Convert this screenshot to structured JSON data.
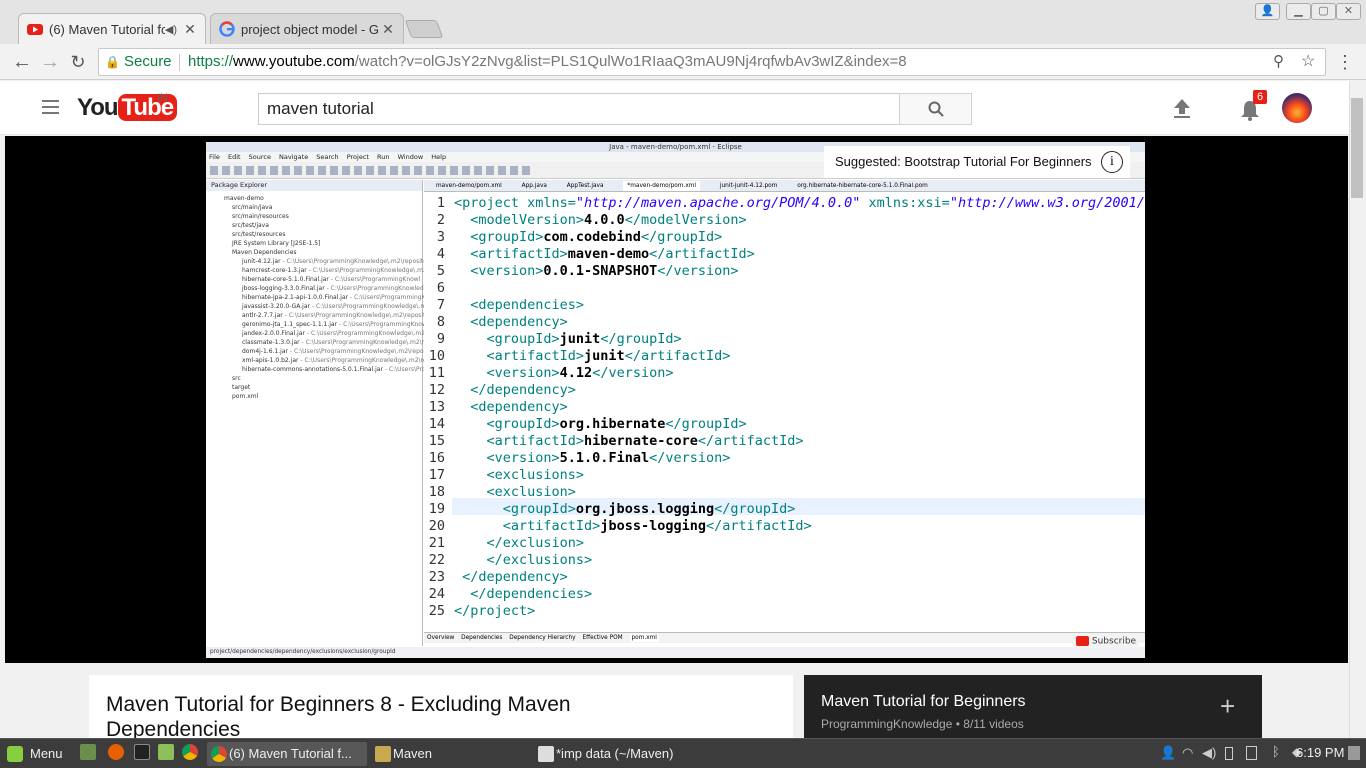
{
  "browser": {
    "tabs": [
      {
        "title": "(6) Maven Tutorial fo",
        "active": true
      },
      {
        "title": "project object model - G",
        "active": false
      }
    ],
    "secure_label": "Secure",
    "url_scheme": "https://",
    "url_host": "www.youtube.com",
    "url_path": "/watch?v=olGJsY2zNvg&list=PLS1QulWo1RIaaQ3mAU9Nj4rqfwbAv3wIZ&index=8"
  },
  "youtube": {
    "logo_text": "YouTube",
    "region": "IN",
    "search_value": "maven tutorial",
    "notification_count": "6"
  },
  "video": {
    "suggested": "Suggested: Bootstrap Tutorial For Beginners",
    "subscribe": "Subscribe",
    "eclipse": {
      "title": "Java - maven-demo/pom.xml - Eclipse",
      "menu": [
        "File",
        "Edit",
        "Source",
        "Navigate",
        "Search",
        "Project",
        "Run",
        "Window",
        "Help"
      ],
      "package_explorer_title": "Package Explorer",
      "tree": [
        {
          "label": "maven-demo",
          "path": ""
        },
        {
          "label": "src/main/java",
          "path": ""
        },
        {
          "label": "src/main/resources",
          "path": ""
        },
        {
          "label": "src/test/java",
          "path": ""
        },
        {
          "label": "src/test/resources",
          "path": ""
        },
        {
          "label": "JRE System Library [J2SE-1.5]",
          "path": ""
        },
        {
          "label": "Maven Dependencies",
          "path": ""
        },
        {
          "label": "junit-4.12.jar",
          "path": " - C:\\Users\\ProgrammingKnowledge\\.m2\\repository"
        },
        {
          "label": "hamcrest-core-1.3.jar",
          "path": " - C:\\Users\\ProgrammingKnowledge\\.m2\\re"
        },
        {
          "label": "hibernate-core-5.1.0.Final.jar",
          "path": " - C:\\Users\\ProgrammingKnowl"
        },
        {
          "label": "jboss-logging-3.3.0.Final.jar",
          "path": " - C:\\Users\\ProgrammingKnowledg"
        },
        {
          "label": "hibernate-jpa-2.1-api-1.0.0.Final.jar",
          "path": " - C:\\Users\\ProgrammingK"
        },
        {
          "label": "javassist-3.20.0-GA.jar",
          "path": " - C:\\Users\\ProgrammingKnowledge\\.m2"
        },
        {
          "label": "antlr-2.7.7.jar",
          "path": " - C:\\Users\\ProgrammingKnowledge\\.m2\\repositor"
        },
        {
          "label": "geronimo-jta_1.1_spec-1.1.1.jar",
          "path": " - C:\\Users\\ProgrammingKnowl"
        },
        {
          "label": "jandex-2.0.0.Final.jar",
          "path": " - C:\\Users\\ProgrammingKnowledge\\.m2\\re"
        },
        {
          "label": "classmate-1.3.0.jar",
          "path": " - C:\\Users\\ProgrammingKnowledge\\.m2\\repo"
        },
        {
          "label": "dom4j-1.6.1.jar",
          "path": " - C:\\Users\\ProgrammingKnowledge\\.m2\\reposito"
        },
        {
          "label": "xml-apis-1.0.b2.jar",
          "path": " - C:\\Users\\ProgrammingKnowledge\\.m2\\repo"
        },
        {
          "label": "hibernate-commons-annotations-5.0.1.Final.jar",
          "path": " - C:\\Users\\Progra"
        },
        {
          "label": "src",
          "path": ""
        },
        {
          "label": "target",
          "path": ""
        },
        {
          "label": "pom.xml",
          "path": ""
        }
      ],
      "editor_tabs": [
        "maven-demo/pom.xml",
        "App.java",
        "AppTest.java",
        "*maven-demo/pom.xml",
        "junit-junit-4.12.pom",
        "org.hibernate-hibernate-core-5.1.0.Final.pom"
      ],
      "code_lines": [
        {
          "n": "1",
          "parts": [
            [
              "tag",
              "<project xmlns="
            ],
            [
              "str",
              "\"http://maven.apache.org/POM/4.0.0\""
            ],
            [
              "tag",
              " xmlns:xsi="
            ],
            [
              "str",
              "\"http://www.w3.org/2001/"
            ]
          ]
        },
        {
          "n": "2",
          "parts": [
            [
              "tag",
              "  <modelVersion>"
            ],
            [
              "txt",
              "4.0.0"
            ],
            [
              "tag",
              "</modelVersion>"
            ]
          ]
        },
        {
          "n": "3",
          "parts": [
            [
              "tag",
              "  <groupId>"
            ],
            [
              "txt",
              "com.codebind"
            ],
            [
              "tag",
              "</groupId>"
            ]
          ]
        },
        {
          "n": "4",
          "parts": [
            [
              "tag",
              "  <artifactId>"
            ],
            [
              "txt",
              "maven-demo"
            ],
            [
              "tag",
              "</artifactId>"
            ]
          ]
        },
        {
          "n": "5",
          "parts": [
            [
              "tag",
              "  <version>"
            ],
            [
              "txt",
              "0.0.1-SNAPSHOT"
            ],
            [
              "tag",
              "</version>"
            ]
          ]
        },
        {
          "n": "6",
          "parts": []
        },
        {
          "n": "7",
          "parts": [
            [
              "tag",
              "  <dependencies>"
            ]
          ]
        },
        {
          "n": "8",
          "parts": [
            [
              "tag",
              "  <dependency>"
            ]
          ]
        },
        {
          "n": "9",
          "parts": [
            [
              "tag",
              "    <groupId>"
            ],
            [
              "txt",
              "junit"
            ],
            [
              "tag",
              "</groupId>"
            ]
          ]
        },
        {
          "n": "10",
          "parts": [
            [
              "tag",
              "    <artifactId>"
            ],
            [
              "txt",
              "junit"
            ],
            [
              "tag",
              "</artifactId>"
            ]
          ]
        },
        {
          "n": "11",
          "parts": [
            [
              "tag",
              "    <version>"
            ],
            [
              "txt",
              "4.12"
            ],
            [
              "tag",
              "</version>"
            ]
          ]
        },
        {
          "n": "12",
          "parts": [
            [
              "tag",
              "  </dependency>"
            ]
          ]
        },
        {
          "n": "13",
          "parts": [
            [
              "tag",
              "  <dependency>"
            ]
          ]
        },
        {
          "n": "14",
          "parts": [
            [
              "tag",
              "    <groupId>"
            ],
            [
              "txt",
              "org.hibernate"
            ],
            [
              "tag",
              "</groupId>"
            ]
          ]
        },
        {
          "n": "15",
          "parts": [
            [
              "tag",
              "    <artifactId>"
            ],
            [
              "txt",
              "hibernate-core"
            ],
            [
              "tag",
              "</artifactId>"
            ]
          ]
        },
        {
          "n": "16",
          "parts": [
            [
              "tag",
              "    <version>"
            ],
            [
              "txt",
              "5.1.0.Final"
            ],
            [
              "tag",
              "</version>"
            ]
          ]
        },
        {
          "n": "17",
          "parts": [
            [
              "tag",
              "    <exclusions>"
            ]
          ]
        },
        {
          "n": "18",
          "parts": [
            [
              "tag",
              "    <exclusion>"
            ]
          ]
        },
        {
          "n": "19",
          "parts": [
            [
              "tag",
              "      <groupId>"
            ],
            [
              "txt",
              "org.jboss.logging"
            ],
            [
              "tag",
              "</groupId>"
            ]
          ]
        },
        {
          "n": "20",
          "parts": [
            [
              "tag",
              "      <artifactId>"
            ],
            [
              "txt",
              "jboss-logging"
            ],
            [
              "tag",
              "</artifactId>"
            ]
          ]
        },
        {
          "n": "21",
          "parts": [
            [
              "tag",
              "    </exclusion>"
            ]
          ]
        },
        {
          "n": "22",
          "parts": [
            [
              "tag",
              "    </exclusions>"
            ]
          ]
        },
        {
          "n": "23",
          "parts": [
            [
              "tag",
              " </dependency>"
            ]
          ]
        },
        {
          "n": "24",
          "parts": [
            [
              "tag",
              "  </dependencies>"
            ]
          ]
        },
        {
          "n": "25",
          "parts": [
            [
              "tag",
              "</project>"
            ]
          ]
        }
      ],
      "highlighted_line": "19",
      "bottom_tabs": [
        "Overview",
        "Dependencies",
        "Dependency Hierarchy",
        "Effective POM",
        "pom.xml"
      ],
      "status_path": "project/dependencies/dependency/exclusions/exclusion/groupId"
    }
  },
  "info": {
    "title": "Maven Tutorial for Beginners 8 - Excluding Maven Dependencies"
  },
  "playlist": {
    "title": "Maven Tutorial for Beginners",
    "meta": "ProgrammingKnowledge • 8/11 videos",
    "add": "+"
  },
  "taskbar": {
    "menu": "Menu",
    "tasks": [
      {
        "label": "(6) Maven Tutorial f...",
        "active": true
      },
      {
        "label": "Maven",
        "active": false
      },
      {
        "label": "*imp data (~/Maven)",
        "active": false
      }
    ],
    "clock": "6:19 PM"
  },
  "colors": {
    "youtube_red": "#e62117",
    "secure_green": "#0b8043",
    "xml_tag": "#008080",
    "xml_string": "#2a00ff"
  }
}
